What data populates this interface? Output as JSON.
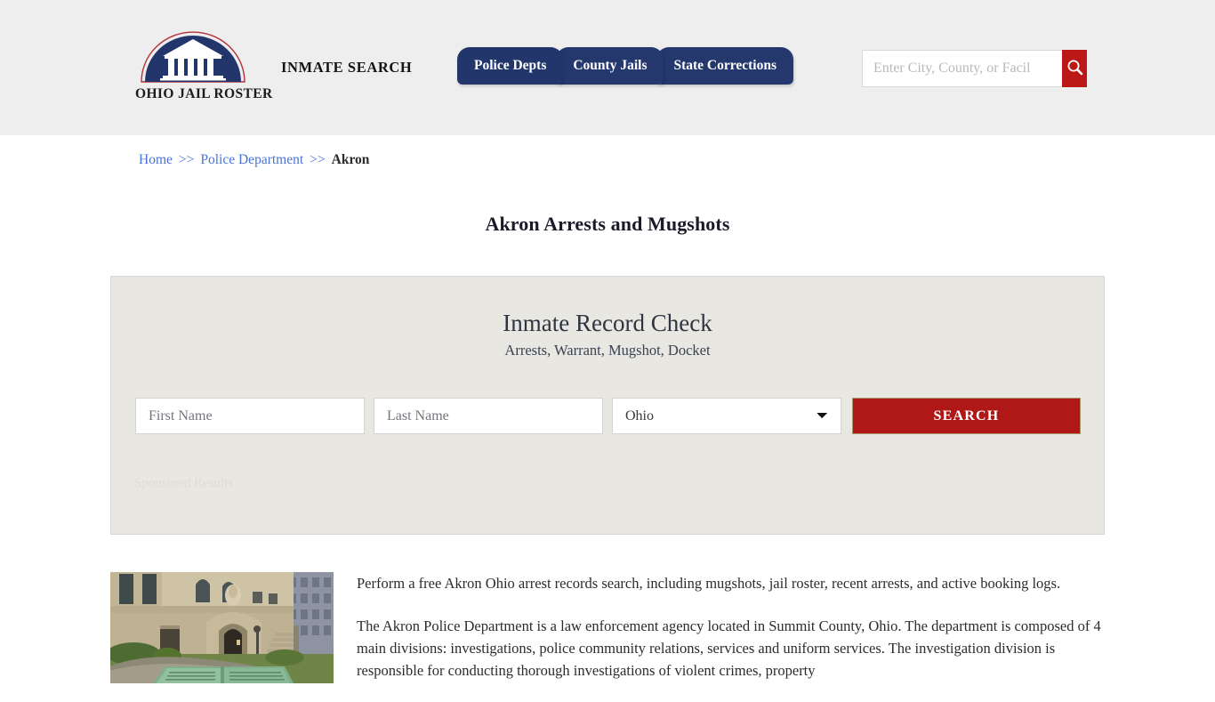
{
  "header": {
    "logo": {
      "wordmark": "OHIO JAIL ROSTER",
      "icon": "courthouse-dome-logo"
    },
    "tagline": "INMATE SEARCH",
    "nav": [
      {
        "label": "Police Depts"
      },
      {
        "label": "County Jails"
      },
      {
        "label": "State Corrections"
      }
    ],
    "search": {
      "placeholder": "Enter City, County, or Facil",
      "value": "",
      "button_icon": "search-icon"
    },
    "background_color": "#eeeeee"
  },
  "breadcrumb": {
    "home": "Home",
    "separator": ">>",
    "parent": "Police Department",
    "current": "Akron"
  },
  "page": {
    "title": "Akron Arrests and Mugshots"
  },
  "record_panel": {
    "title": "Inmate Record Check",
    "subtitle": "Arrests, Warrant, Mugshot, Docket",
    "first_name_placeholder": "First Name",
    "first_name_value": "",
    "last_name_placeholder": "Last Name",
    "last_name_value": "",
    "state_selected": "Ohio",
    "state_options": [
      "Ohio"
    ],
    "search_button": "SEARCH",
    "sponsored_label": "Sponsored Results",
    "accent_color": "#b01818",
    "panel_color": "#e9e7e2"
  },
  "article": {
    "photo_alt": "akron-summit-county-courthouse-photo",
    "paragraphs": [
      "Perform a free Akron Ohio arrest records search, including mugshots, jail roster, recent arrests, and active booking logs.",
      "The Akron Police Department is a law enforcement agency located in Summit County, Ohio. The department is composed of 4 main divisions: investigations, police community relations, services and uniform services. The investigation division is responsible for conducting thorough investigations of violent crimes, property"
    ]
  }
}
